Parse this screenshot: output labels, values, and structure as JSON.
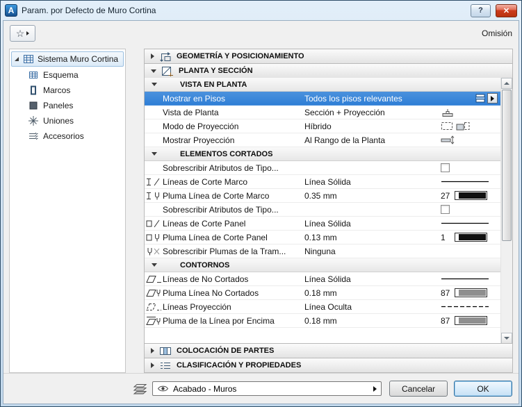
{
  "colors": {
    "selection_blue": "#2f7fd6",
    "pen_black": "#111111",
    "pen_gray": "#8f8f8f"
  },
  "window": {
    "title": "Param. por Defecto de Muro Cortina",
    "help_glyph": "?",
    "close_glyph": "✕"
  },
  "toolbar": {
    "favorites_glyph": "☆",
    "omission_label": "Omisión"
  },
  "sidebar": {
    "root": "Sistema Muro Cortina",
    "items": [
      {
        "icon": "scheme-grid-icon",
        "label": "Esquema"
      },
      {
        "icon": "frame-icon",
        "label": "Marcos"
      },
      {
        "icon": "panel-icon",
        "label": "Paneles"
      },
      {
        "icon": "junction-icon",
        "label": "Uniones"
      },
      {
        "icon": "accessories-icon",
        "label": "Accesorios"
      }
    ]
  },
  "accordion": {
    "sections": [
      {
        "icon": "geometry-icon",
        "label": "GEOMETRÍA Y POSICIONAMIENTO",
        "expanded": false
      },
      {
        "icon": "plan-section-icon",
        "label": "PLANTA Y SECCIÓN",
        "expanded": true
      },
      {
        "icon": "parts-icon",
        "label": "COLOCACIÓN DE PARTES",
        "expanded": false
      },
      {
        "icon": "classification-icon",
        "label": "CLASIFICACIÓN Y PROPIEDADES",
        "expanded": false
      }
    ]
  },
  "plan_panel": {
    "groups": [
      {
        "title": "VISTA EN PLANTA",
        "rows": [
          {
            "type": "select",
            "label": "Mostrar en Pisos",
            "value": "Todos los pisos relevantes",
            "selected": true,
            "right_icons": [
              "floors-icon",
              "flyout-arrow-button"
            ]
          },
          {
            "type": "select",
            "label": "Vista de Planta",
            "value": "Sección + Proyección",
            "right_icons": [
              "plan-view-icon"
            ]
          },
          {
            "type": "select",
            "label": "Modo de Proyección",
            "value": "Híbrido",
            "right_icons": [
              "dashed-box-icon",
              "hybrid-icon"
            ]
          },
          {
            "type": "select",
            "label": "Mostrar Proyección",
            "value": "Al Rango de la Planta",
            "right_icons": [
              "floor-range-icon"
            ]
          }
        ]
      },
      {
        "title": "ELEMENTOS CORTADOS",
        "rows": [
          {
            "type": "checkbox",
            "label": "Sobrescribir Atributos de Tipo...",
            "checked": false
          },
          {
            "type": "linetype",
            "icon": "frame-cut-line-icon",
            "label": "Líneas de Corte Marco",
            "value": "Línea Sólida",
            "line_style": "solid"
          },
          {
            "type": "pen",
            "icon": "frame-cut-pen-icon",
            "label": "Pluma Línea de Corte Marco",
            "value": "0.35 mm",
            "pen_number": "27",
            "pen_color": "#111111"
          },
          {
            "type": "checkbox",
            "label": "Sobrescribir Atributos de Tipo...",
            "checked": false
          },
          {
            "type": "linetype",
            "icon": "panel-cut-line-icon",
            "label": "Líneas de Corte Panel",
            "value": "Línea Sólida",
            "line_style": "solid"
          },
          {
            "type": "pen",
            "icon": "panel-cut-pen-icon",
            "label": "Pluma Línea de Corte Panel",
            "value": "0.13 mm",
            "pen_number": "1",
            "pen_color": "#111111"
          },
          {
            "type": "select",
            "icon": "fill-pen-icon",
            "label": "Sobrescribir Plumas de la Tram...",
            "value": "Ninguna"
          }
        ]
      },
      {
        "title": "CONTORNOS",
        "rows": [
          {
            "type": "linetype",
            "icon": "uncut-line-icon",
            "label": "Líneas de No Cortados",
            "value": "Línea Sólida",
            "line_style": "solid"
          },
          {
            "type": "pen",
            "icon": "uncut-pen-icon",
            "label": "Pluma Línea No Cortados",
            "value": "0.18 mm",
            "pen_number": "87",
            "pen_color": "#8f8f8f"
          },
          {
            "type": "linetype",
            "icon": "projection-line-icon",
            "label": "Líneas Proyección",
            "value": "Línea Oculta",
            "line_style": "dashed"
          },
          {
            "type": "pen",
            "icon": "above-line-pen-icon",
            "label": "Pluma de la Línea por Encima",
            "value": "0.18 mm",
            "pen_number": "87",
            "pen_color": "#8f8f8f"
          }
        ]
      }
    ]
  },
  "footer": {
    "surface_combo_value": "Acabado - Muros",
    "cancel_label": "Cancelar",
    "ok_label": "OK"
  }
}
